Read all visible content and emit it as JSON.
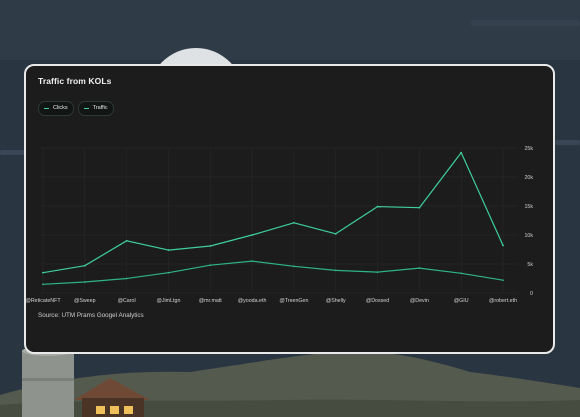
{
  "card": {
    "title": "Traffic from KOLs",
    "source": "Source: UTM Prams Googel Analytics"
  },
  "legend": [
    {
      "label": "Clicks",
      "color": "#3ecf9a"
    },
    {
      "label": "Traffic",
      "color": "#3ecf9a"
    }
  ],
  "colors": {
    "card_bg": "#1c1c1c",
    "card_border": "#e9e9e9",
    "line_upper": "#3ecf9a",
    "line_lower": "#2fb585",
    "grid": "#2a2a2a",
    "sky": "#2a3542",
    "hills": "#555a4e"
  },
  "chart_data": {
    "type": "line",
    "categories": [
      "@ReticateNFT",
      "@Sweep",
      "@Carol",
      "@JimLtgn",
      "@mr.matt",
      "@yooda.eth",
      "@TreenGen",
      "@Shelly",
      "@Dossed",
      "@Devin",
      "@GIU",
      "@robert.eth"
    ],
    "series": [
      {
        "values": [
          3500,
          4700,
          9000,
          7400,
          8100,
          10000,
          12100,
          10200,
          14900,
          14700,
          24200,
          8200
        ]
      },
      {
        "values": [
          1500,
          1900,
          2500,
          3500,
          4800,
          5500,
          4600,
          3900,
          3600,
          4300,
          3400,
          2200
        ]
      }
    ],
    "yticks": [
      "0",
      "5k",
      "10k",
      "15k",
      "20k",
      "25k"
    ],
    "ylim": [
      0,
      25000
    ],
    "grid": true,
    "legend_position": "top-left"
  }
}
